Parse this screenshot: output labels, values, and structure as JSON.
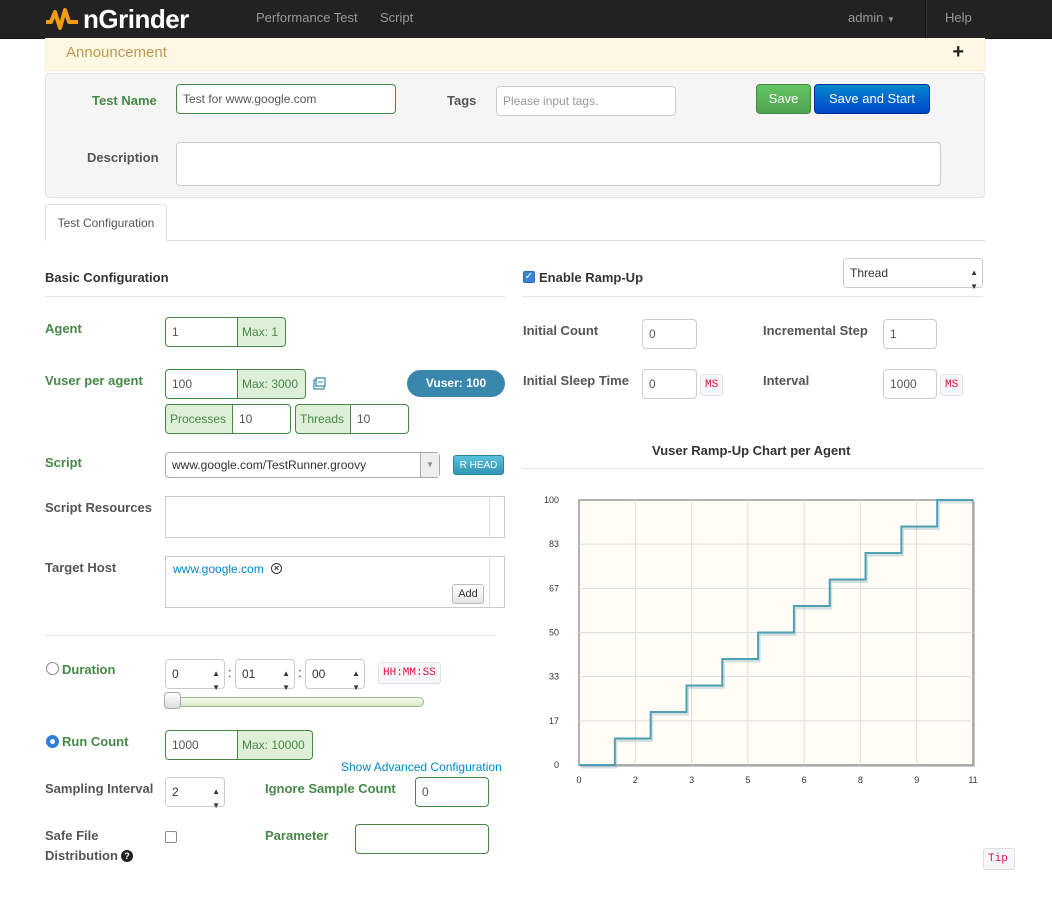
{
  "nav": {
    "brand": "nGrinder",
    "performance_test": "Performance Test",
    "script": "Script",
    "user": "admin",
    "help": "Help"
  },
  "announcement": {
    "title": "Announcement",
    "toggle": "+"
  },
  "header": {
    "test_name_label": "Test Name",
    "test_name_value": "Test for www.google.com",
    "tags_label": "Tags",
    "tags_placeholder": "Please input tags.",
    "save_label": "Save",
    "save_start_label": "Save and Start",
    "description_label": "Description",
    "description_value": ""
  },
  "tabs": [
    {
      "label": "Test Configuration"
    }
  ],
  "basic": {
    "title": "Basic Configuration",
    "agent_label": "Agent",
    "agent_value": "1",
    "agent_max": "Max: 1",
    "vuser_label": "Vuser per agent",
    "vuser_value": "100",
    "vuser_max": "Max: 3000",
    "vuser_total": "Vuser: 100",
    "processes_label": "Processes",
    "processes_value": "10",
    "threads_label": "Threads",
    "threads_value": "10",
    "script_label": "Script",
    "script_value": "www.google.com/TestRunner.groovy",
    "rhead_label": "R HEAD",
    "resources_label": "Script Resources",
    "target_host_label": "Target Host",
    "target_host_value": "www.google.com",
    "add_label": "Add",
    "duration_label": "Duration",
    "duration_h": "0",
    "duration_m": "01",
    "duration_s": "00",
    "duration_format": "HH:MM:SS",
    "duration_slider_value": 0,
    "run_count_label": "Run Count",
    "run_count_value": "1000",
    "run_count_max": "Max: 10000",
    "advanced_link": "Show Advanced Configuration",
    "sampling_label": "Sampling Interval",
    "sampling_value": "2",
    "ignore_label": "Ignore Sample Count",
    "ignore_value": "0",
    "safe_file_label_1": "Safe File",
    "safe_file_label_2": "Distribution",
    "parameter_label": "Parameter",
    "parameter_value": ""
  },
  "rampup": {
    "enable_label": "Enable Ramp-Up",
    "enabled": true,
    "type_value": "Thread",
    "initial_count_label": "Initial Count",
    "initial_count_value": "0",
    "incremental_step_label": "Incremental Step",
    "incremental_step_value": "1",
    "initial_sleep_label": "Initial Sleep Time",
    "initial_sleep_value": "0",
    "interval_label": "Interval",
    "interval_value": "1000",
    "ms_unit": "MS",
    "chart_title": "Vuser Ramp-Up Chart per Agent"
  },
  "tip": "Tip",
  "colors": {
    "nav_bg": "#222222",
    "label_green": "#468847",
    "chart_line": "#4f9fb5",
    "chart_bg": "#fffdf5",
    "vuser_badge": "#3a87ad"
  },
  "chart_data": {
    "type": "line",
    "title": "Vuser Ramp-Up Chart per Agent",
    "x_ticks": [
      "0",
      "2",
      "3",
      "5",
      "6",
      "8",
      "9",
      "11"
    ],
    "y_ticks": [
      "0",
      "17",
      "33",
      "50",
      "67",
      "83",
      "100"
    ],
    "xlim": [
      0,
      11
    ],
    "ylim": [
      0,
      100
    ],
    "series": [
      {
        "values": [
          [
            0,
            0
          ],
          [
            1.0,
            0
          ],
          [
            1.0,
            10
          ],
          [
            2.0,
            10
          ],
          [
            2.0,
            20
          ],
          [
            3.0,
            20
          ],
          [
            3.0,
            30
          ],
          [
            4.0,
            30
          ],
          [
            4.0,
            40
          ],
          [
            5.0,
            40
          ],
          [
            5.0,
            50
          ],
          [
            6.0,
            50
          ],
          [
            6.0,
            60
          ],
          [
            7.0,
            60
          ],
          [
            7.0,
            70
          ],
          [
            8.0,
            70
          ],
          [
            8.0,
            80
          ],
          [
            9.0,
            80
          ],
          [
            9.0,
            90
          ],
          [
            10.0,
            90
          ],
          [
            10.0,
            100
          ],
          [
            11.0,
            100
          ]
        ]
      }
    ]
  }
}
